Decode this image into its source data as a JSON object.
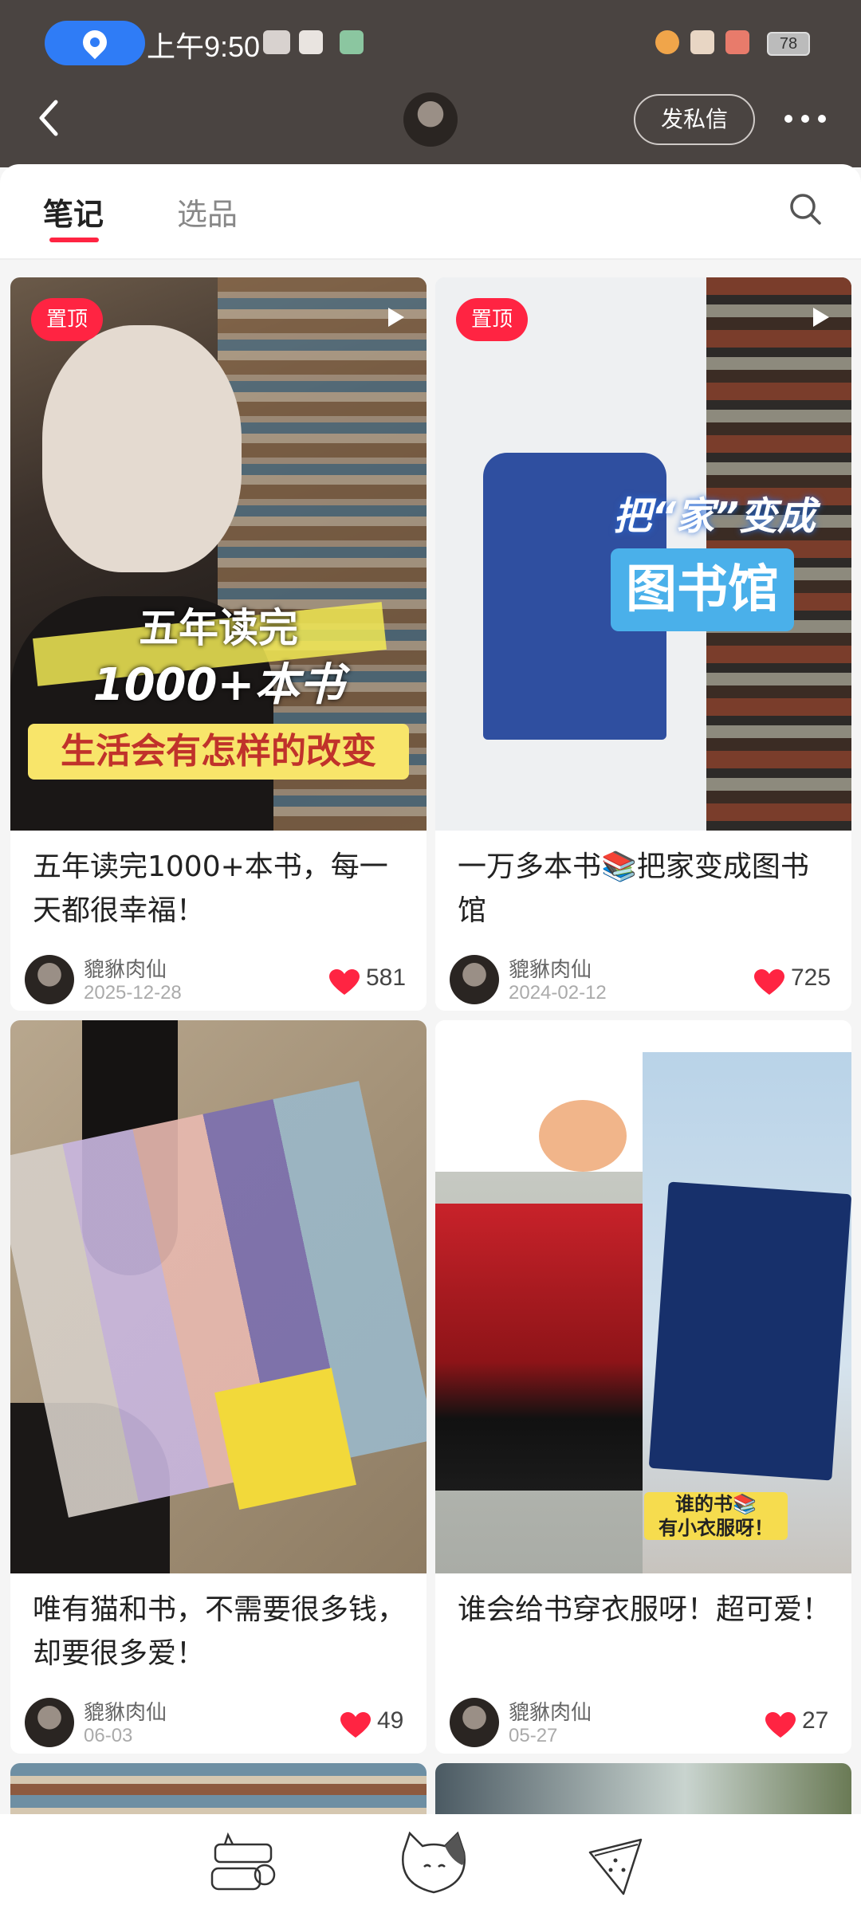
{
  "status_bar": {
    "time": "上午9:50",
    "battery": "78"
  },
  "header": {
    "back_icon": "chevron-left-icon",
    "dm_button": "发私信",
    "more_icon": "more-dots-icon"
  },
  "tabs": [
    {
      "label": "笔记",
      "active": true
    },
    {
      "label": "选品",
      "active": false
    }
  ],
  "search_icon": "search-icon",
  "notes": [
    {
      "title": "五年读完1000+本书，每一天都很幸福！",
      "author": "貔貅肉仙",
      "date": "2025-12-28",
      "likes": "581",
      "pinned": true,
      "pinned_label": "置顶",
      "video": true,
      "cover_text": [
        "五年读完",
        "1000+本书",
        "生活会有怎样的改变"
      ]
    },
    {
      "title": "一万多本书📚把家变成图书馆",
      "author": "貔貅肉仙",
      "date": "2024-02-12",
      "likes": "725",
      "pinned": true,
      "pinned_label": "置顶",
      "video": true,
      "cover_text": [
        "把“家”变成",
        "图书馆"
      ]
    },
    {
      "title": "唯有猫和书，不需要很多钱，却要很多爱！",
      "author": "貔貅肉仙",
      "date": "06-03",
      "likes": "49",
      "pinned": false,
      "video": false
    },
    {
      "title": "谁会给书穿衣服呀！超可爱！",
      "author": "貔貅肉仙",
      "date": "05-27",
      "likes": "27",
      "pinned": false,
      "video": false,
      "cover_text": [
        "谁的书📚",
        "有小衣服呀！"
      ]
    }
  ],
  "colors": {
    "accent": "#ff2442",
    "header_bg": "#4a4441",
    "location_pill": "#2f7cf6"
  },
  "bottom_nav": [
    {
      "icon": "cat-bunny-icon"
    },
    {
      "icon": "cat-face-icon"
    },
    {
      "icon": "watermelon-icon"
    }
  ]
}
